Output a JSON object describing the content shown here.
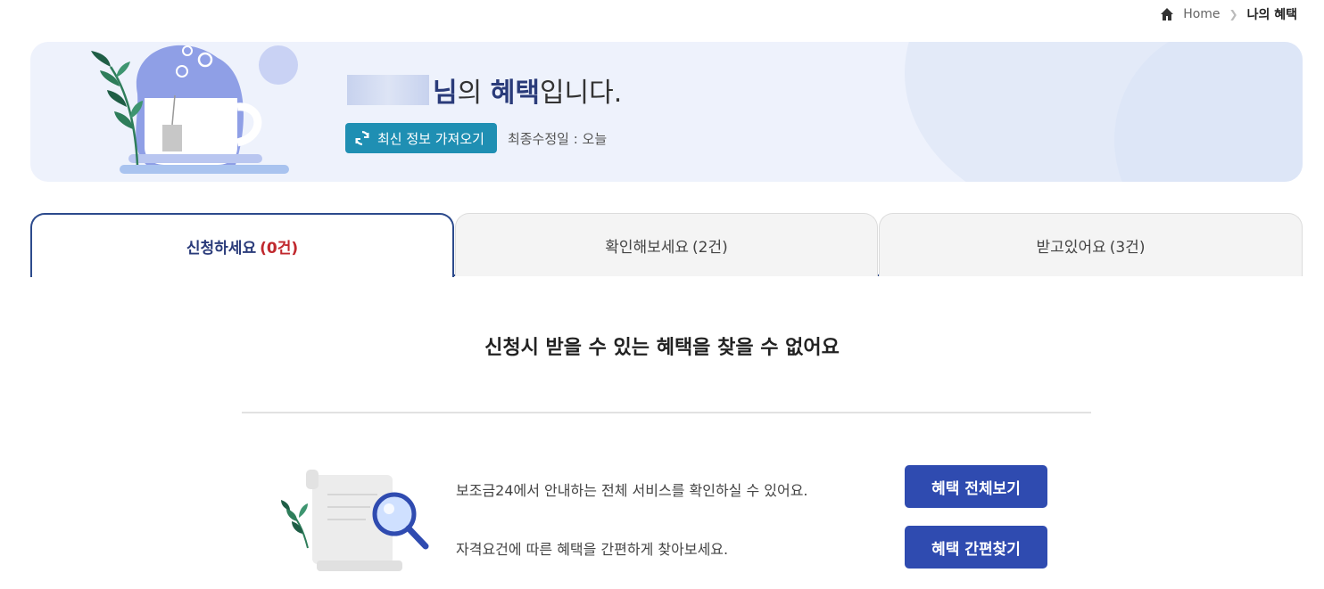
{
  "breadcrumb": {
    "home": "Home",
    "current": "나의 혜택"
  },
  "hero": {
    "title_suffix_1": "님",
    "title_suffix_2": "의 ",
    "title_strong": "혜택",
    "title_suffix_3": "입니다.",
    "refresh_label": "최신 정보 가져오기",
    "updated_label": "최종수정일 : 오늘"
  },
  "tabs": [
    {
      "label": "신청하세요",
      "count": "(0건)"
    },
    {
      "label": "확인해보세요",
      "count": "(2건)"
    },
    {
      "label": "받고있어요",
      "count": "(3건)"
    }
  ],
  "main": {
    "empty_message": "신청시 받을 수 있는 혜택을 찾을 수 없어요",
    "info1": "보조금24에서 안내하는 전체 서비스를 확인하실 수 있어요.",
    "info2": "자격요건에 따른 혜택을 간편하게 찾아보세요.",
    "btn_all": "혜택 전체보기",
    "btn_find": "혜택 간편찾기"
  },
  "colors": {
    "accent_navy": "#2c4a8c",
    "refresh_teal": "#1f8fb3",
    "button_blue": "#2f4bb0",
    "count_red": "#c0282d"
  },
  "icons": {
    "home": "home-icon",
    "refresh": "refresh-icon",
    "magnifier": "magnifier-icon"
  }
}
